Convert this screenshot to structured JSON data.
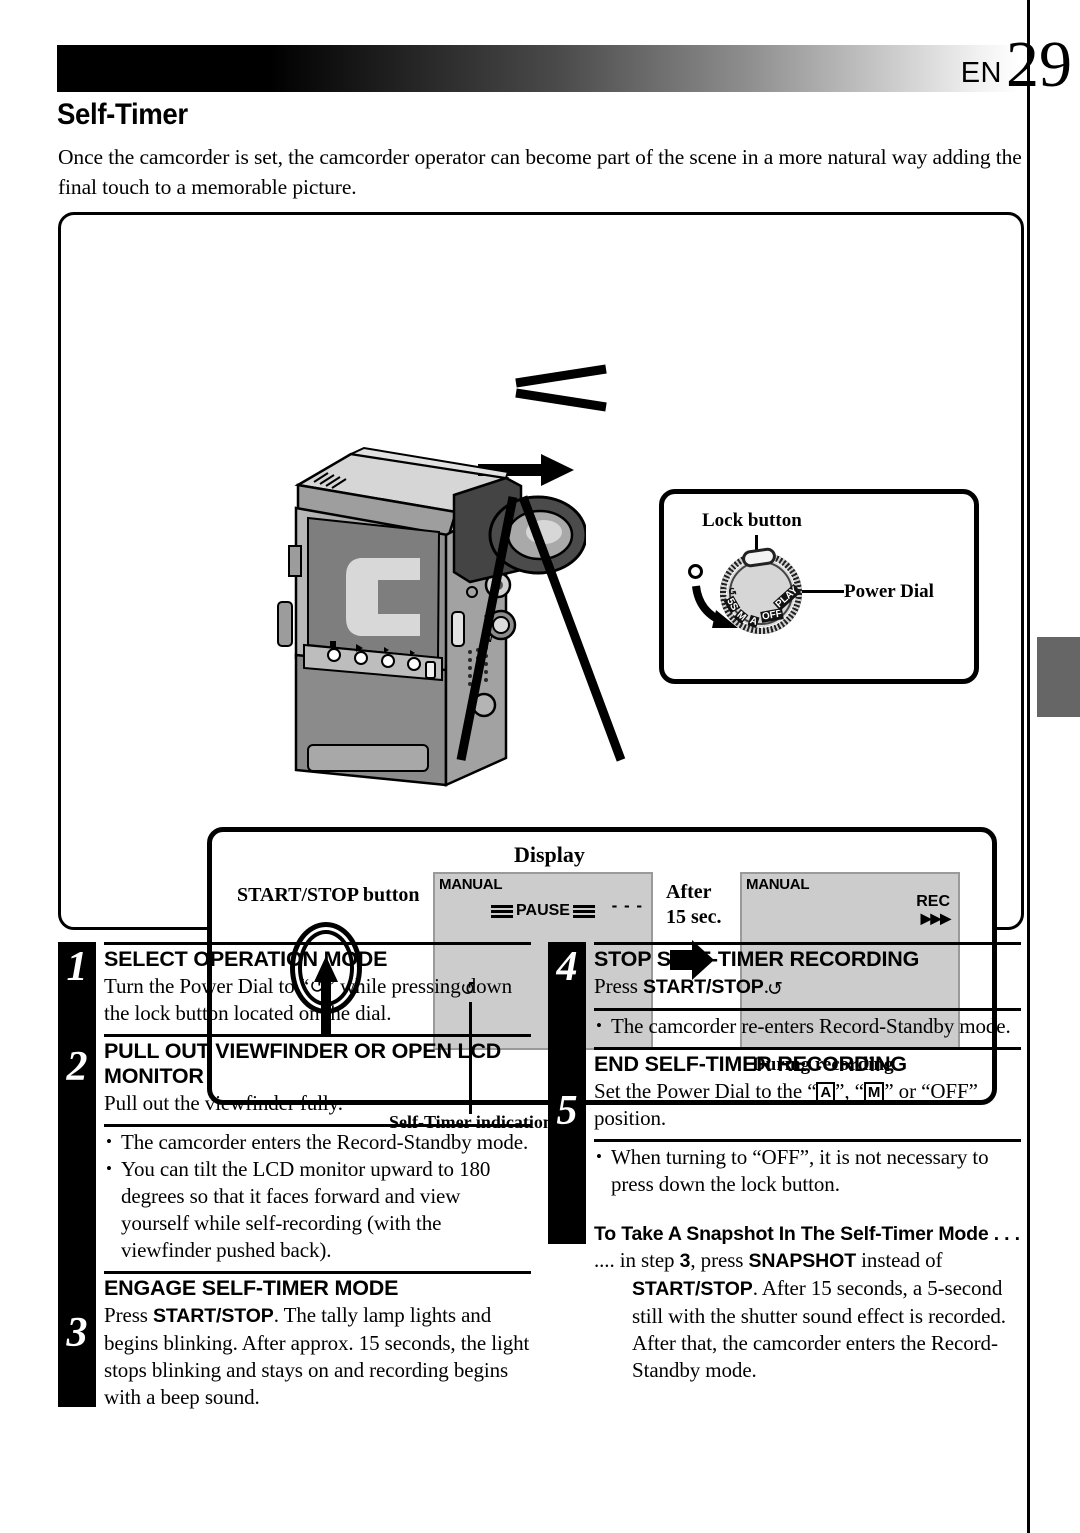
{
  "header": {
    "lang": "EN",
    "page_number": "29"
  },
  "section": {
    "title": "Self-Timer",
    "intro": "Once the camcorder is set, the camcorder operator can become part of the scene in a more natural way adding the final touch to a memorable picture."
  },
  "dial_callout": {
    "lock_button_label": "Lock button",
    "power_dial_label": "Power Dial",
    "dial_positions": [
      "5S",
      "M",
      "A",
      "OFF",
      "PLAY"
    ],
    "self_timer_symbol": "↺"
  },
  "display_callout": {
    "display_label": "Display",
    "start_stop_button_label": "START/STOP button",
    "self_timer_indication_label": "Self-Timer indication",
    "after_label_line1": "After",
    "after_label_line2": "15 sec.",
    "during_recording_label": "During recording",
    "screen_standby": {
      "mode": "MANUAL",
      "dashes": "- - -",
      "status": "PAUSE",
      "timer_icon": "↺"
    },
    "screen_recording": {
      "mode": "MANUAL",
      "status": "REC",
      "triangles": "▶▶▶",
      "timer_icon": "↺"
    }
  },
  "steps_left": [
    {
      "number": "1",
      "heading": "SELECT OPERATION MODE",
      "body_pre": "Turn the Power Dial to “",
      "body_post": "” while pressing down the lock button located on the dial.",
      "symbol": "↺"
    },
    {
      "number": "2",
      "heading": "PULL OUT VIEWFINDER OR OPEN LCD MONITOR",
      "body": "Pull out the viewfinder fully.",
      "bullets": [
        "The camcorder enters the Record-Standby mode.",
        "You can tilt the LCD monitor upward to 180 degrees so that it faces forward and view yourself while self-recording (with the viewfinder pushed back)."
      ]
    },
    {
      "number": "3",
      "heading": "ENGAGE SELF-TIMER MODE",
      "body_pre": "Press ",
      "body_bold": "START/STOP",
      "body_post": ". The tally lamp lights and begins blinking. After approx. 15 seconds, the light stops blinking and stays on and recording begins with a beep sound."
    }
  ],
  "steps_right": [
    {
      "number": "4",
      "heading": "STOP SELF-TIMER RECORDING",
      "body_pre": "Press ",
      "body_bold": "START/STOP",
      "body_post": ".",
      "bullets": [
        "The camcorder re-enters Record-Standby mode."
      ]
    },
    {
      "number": "5",
      "heading": "END SELF-TIMER RECORDING",
      "body_pre": "Set the Power Dial to the “",
      "mode_a": "A",
      "body_mid": "”, “",
      "mode_m": "M",
      "body_post": "” or “OFF” position.",
      "bullets": [
        "When turning to “OFF”, it is not necessary to press down the lock button."
      ]
    }
  ],
  "note": {
    "heading": "To Take A Snapshot In The Self-Timer Mode . . .",
    "lead": ".... in step ",
    "step_ref": "3",
    "mid1": ", press ",
    "bold1": "SNAPSHOT",
    "mid2": " instead of ",
    "bold2": "START/STOP",
    "tail": ". After 15 seconds, a 5-second still with the shutter sound effect is recorded. After that, the camcorder enters the Record-Standby mode."
  }
}
